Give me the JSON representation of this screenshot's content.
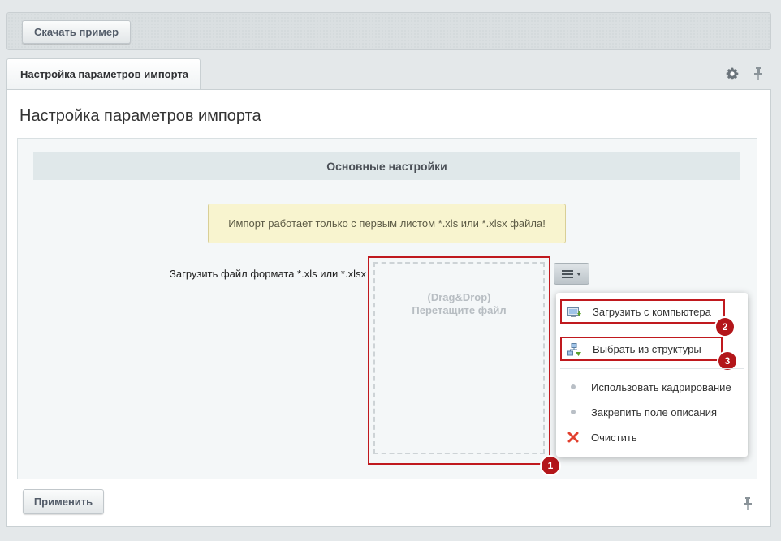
{
  "toolbar": {
    "download_label": "Скачать пример"
  },
  "tab": {
    "label": "Настройка параметров импорта"
  },
  "page": {
    "title": "Настройка параметров импорта"
  },
  "section": {
    "title": "Основные настройки"
  },
  "notice": {
    "text": "Импорт работает только с первым листом *.xls или *.xlsx файла!"
  },
  "upload_field": {
    "label": "Загрузить файл формата *.xls или *.xlsx",
    "drop_line1": "(Drag&Drop)",
    "drop_line2": "Перетащите файл"
  },
  "menu": {
    "items": [
      {
        "label": "Загрузить с компьютера",
        "icon": "computer-upload-icon"
      },
      {
        "label": "Выбрать из структуры",
        "icon": "structure-icon"
      },
      {
        "label": "Использовать кадрирование",
        "icon": "dot-icon"
      },
      {
        "label": "Закрепить поле описания",
        "icon": "dot-icon"
      },
      {
        "label": "Очистить",
        "icon": "close-icon"
      }
    ]
  },
  "badges": [
    "1",
    "2",
    "3"
  ],
  "footer": {
    "apply_label": "Применить"
  },
  "colors": {
    "highlight": "#c0191e",
    "badge": "#b3161a",
    "notice_bg": "#f8f4cf",
    "section_bg": "#e0e8ea"
  }
}
